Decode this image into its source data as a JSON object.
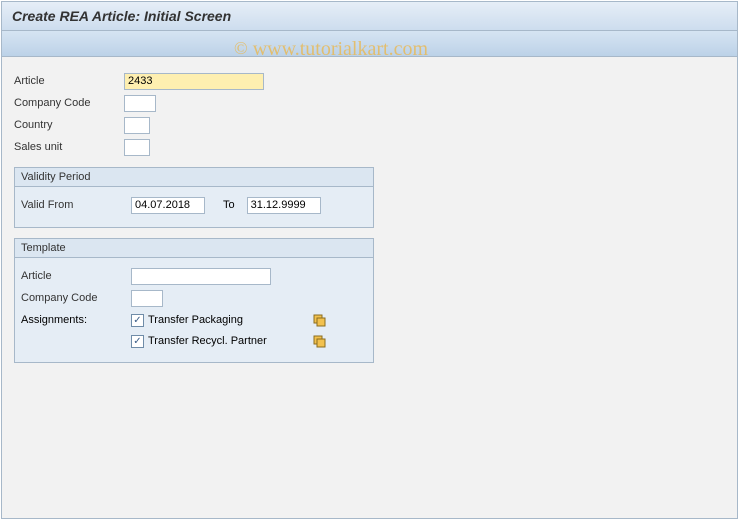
{
  "header": {
    "title": "Create REA Article: Initial Screen"
  },
  "fields": {
    "article_label": "Article",
    "article_value": "2433",
    "company_code_label": "Company Code",
    "company_code_value": "",
    "country_label": "Country",
    "country_value": "",
    "sales_unit_label": "Sales unit",
    "sales_unit_value": ""
  },
  "validity": {
    "title": "Validity Period",
    "from_label": "Valid From",
    "from_value": "04.07.2018",
    "to_label": "To",
    "to_value": "31.12.9999"
  },
  "template": {
    "title": "Template",
    "article_label": "Article",
    "article_value": "",
    "company_code_label": "Company Code",
    "company_code_value": "",
    "assignments_label": "Assignments:",
    "transfer_packaging_label": "Transfer Packaging",
    "transfer_packaging_checked": true,
    "transfer_recycl_label": "Transfer Recycl. Partner",
    "transfer_recycl_checked": true
  },
  "watermark": {
    "copy": "©",
    "text": " www.tutorialkart.com"
  }
}
